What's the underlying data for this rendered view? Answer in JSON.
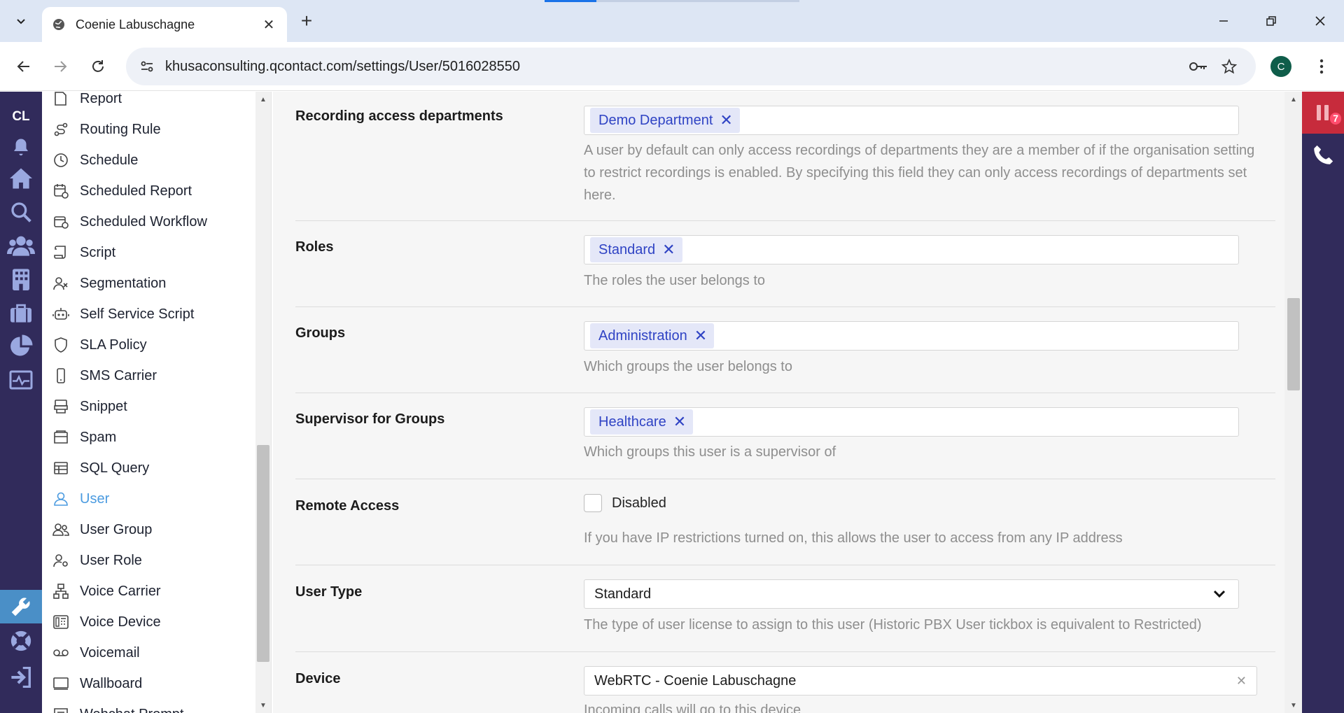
{
  "browser": {
    "tab_title": "Coenie Labuschagne",
    "url": "khusaconsulting.qcontact.com/settings/User/5016028550",
    "profile_initial": "C"
  },
  "app": {
    "user_initials": "CL",
    "notification_count": "7"
  },
  "sidebar": {
    "items": [
      {
        "label": "Report",
        "icon": "report-icon"
      },
      {
        "label": "Routing Rule",
        "icon": "routing-icon"
      },
      {
        "label": "Schedule",
        "icon": "clock-icon"
      },
      {
        "label": "Scheduled Report",
        "icon": "calendar-clock-icon"
      },
      {
        "label": "Scheduled Workflow",
        "icon": "workflow-icon"
      },
      {
        "label": "Script",
        "icon": "scroll-icon"
      },
      {
        "label": "Segmentation",
        "icon": "segment-icon"
      },
      {
        "label": "Self Service Script",
        "icon": "robot-icon"
      },
      {
        "label": "SLA Policy",
        "icon": "shield-icon"
      },
      {
        "label": "SMS Carrier",
        "icon": "mobile-icon"
      },
      {
        "label": "Snippet",
        "icon": "snippet-icon"
      },
      {
        "label": "Spam",
        "icon": "spam-icon"
      },
      {
        "label": "SQL Query",
        "icon": "table-icon"
      },
      {
        "label": "User",
        "icon": "user-icon"
      },
      {
        "label": "User Group",
        "icon": "users-icon"
      },
      {
        "label": "User Role",
        "icon": "user-role-icon"
      },
      {
        "label": "Voice Carrier",
        "icon": "network-icon"
      },
      {
        "label": "Voice Device",
        "icon": "phone-device-icon"
      },
      {
        "label": "Voicemail",
        "icon": "voicemail-icon"
      },
      {
        "label": "Wallboard",
        "icon": "monitor-icon"
      },
      {
        "label": "Webchat Prompt",
        "icon": "chat-icon"
      }
    ],
    "active_item": "User"
  },
  "form": {
    "recording_access": {
      "label": "Recording access departments",
      "tag": "Demo Department",
      "help": "A user by default can only access recordings of departments they are a member of if the organisation setting to restrict recordings is enabled. By specifying this field they can only access recordings of departments set here."
    },
    "roles": {
      "label": "Roles",
      "tag": "Standard",
      "help": "The roles the user belongs to"
    },
    "groups": {
      "label": "Groups",
      "tag": "Administration",
      "help": "Which groups the user belongs to"
    },
    "supervisor_groups": {
      "label": "Supervisor for Groups",
      "tag": "Healthcare",
      "help": "Which groups this user is a supervisor of"
    },
    "remote_access": {
      "label": "Remote Access",
      "checkbox_label": "Disabled",
      "help": "If you have IP restrictions turned on, this allows the user to access from any IP address"
    },
    "user_type": {
      "label": "User Type",
      "value": "Standard",
      "help": "The type of user license to assign to this user (Historic PBX User tickbox is equivalent to Restricted)"
    },
    "device": {
      "label": "Device",
      "value": "WebRTC - Coenie Labuschagne",
      "help": "Incoming calls will go to this device"
    }
  }
}
